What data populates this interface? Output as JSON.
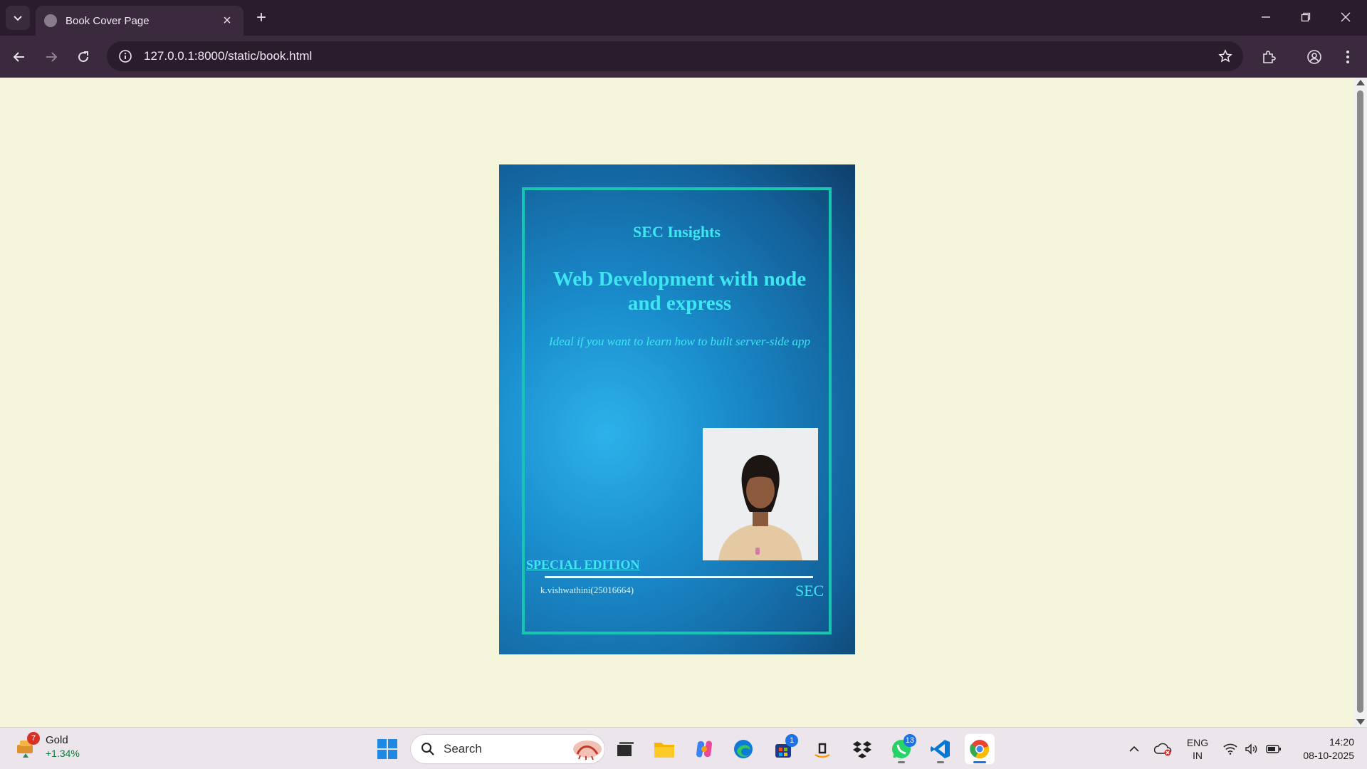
{
  "browser": {
    "tab": {
      "title": "Book Cover Page",
      "close_glyph": "×"
    },
    "new_tab_glyph": "+",
    "address": {
      "url": "127.0.0.1:8000/static/book.html"
    }
  },
  "book": {
    "series": "SEC Insights",
    "title": "Web Development with node and express",
    "subtitle": "Ideal if you want to learn how to built server-side app",
    "edition": "SPECIAL EDITION",
    "author": "k.vishwathini(25016664)",
    "publisher": "SEC",
    "colors": {
      "background": "#f5f5dc",
      "cover_blue": "#1a8ccc",
      "frame": "#17c6b0",
      "text": "#3ee6f0"
    }
  },
  "taskbar": {
    "widget": {
      "badge": "7",
      "title": "Gold",
      "change": "+1.34%"
    },
    "search": {
      "placeholder": "Search"
    },
    "apps": [
      {
        "name": "start-button",
        "icon": "windows-logo-icon"
      },
      {
        "name": "task-view",
        "icon": "task-view-icon"
      },
      {
        "name": "file-explorer",
        "icon": "folder-icon"
      },
      {
        "name": "copilot",
        "icon": "copilot-icon"
      },
      {
        "name": "edge",
        "icon": "edge-icon"
      },
      {
        "name": "microsoft-store",
        "icon": "store-icon",
        "badge": "1"
      },
      {
        "name": "amazon",
        "icon": "amazon-icon"
      },
      {
        "name": "dropbox",
        "icon": "dropbox-icon"
      },
      {
        "name": "whatsapp",
        "icon": "whatsapp-icon",
        "badge": "13"
      },
      {
        "name": "vscode",
        "icon": "vscode-icon"
      },
      {
        "name": "chrome",
        "icon": "chrome-icon"
      }
    ],
    "tray": {
      "language": "ENG",
      "region": "IN",
      "time": "14:20",
      "date": "08-10-2025"
    }
  }
}
